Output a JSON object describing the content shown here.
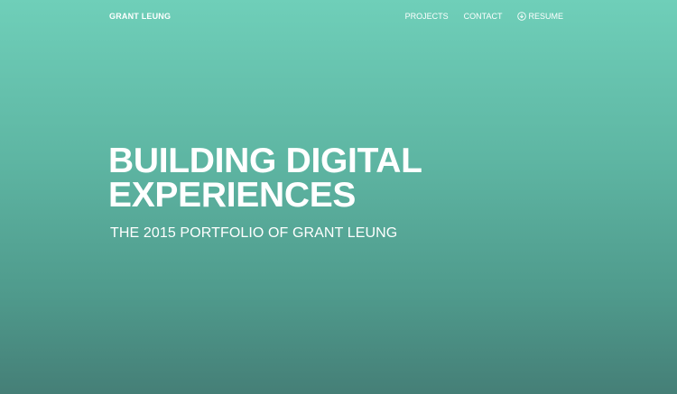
{
  "header": {
    "brand": "GRANT LEUNG",
    "nav": {
      "projects": "PROJECTS",
      "contact": "CONTACT",
      "resume": "RESUME"
    },
    "resume_icon": "download-icon"
  },
  "hero": {
    "headline_line1": "BUILDING DIGITAL",
    "headline_line2": "EXPERIENCES",
    "subhead": "THE 2015 PORTFOLIO OF GRANT LEUNG"
  },
  "colors": {
    "gradient_top": "#6fcfb9",
    "gradient_bottom": "#457f77",
    "text": "#ffffff"
  }
}
